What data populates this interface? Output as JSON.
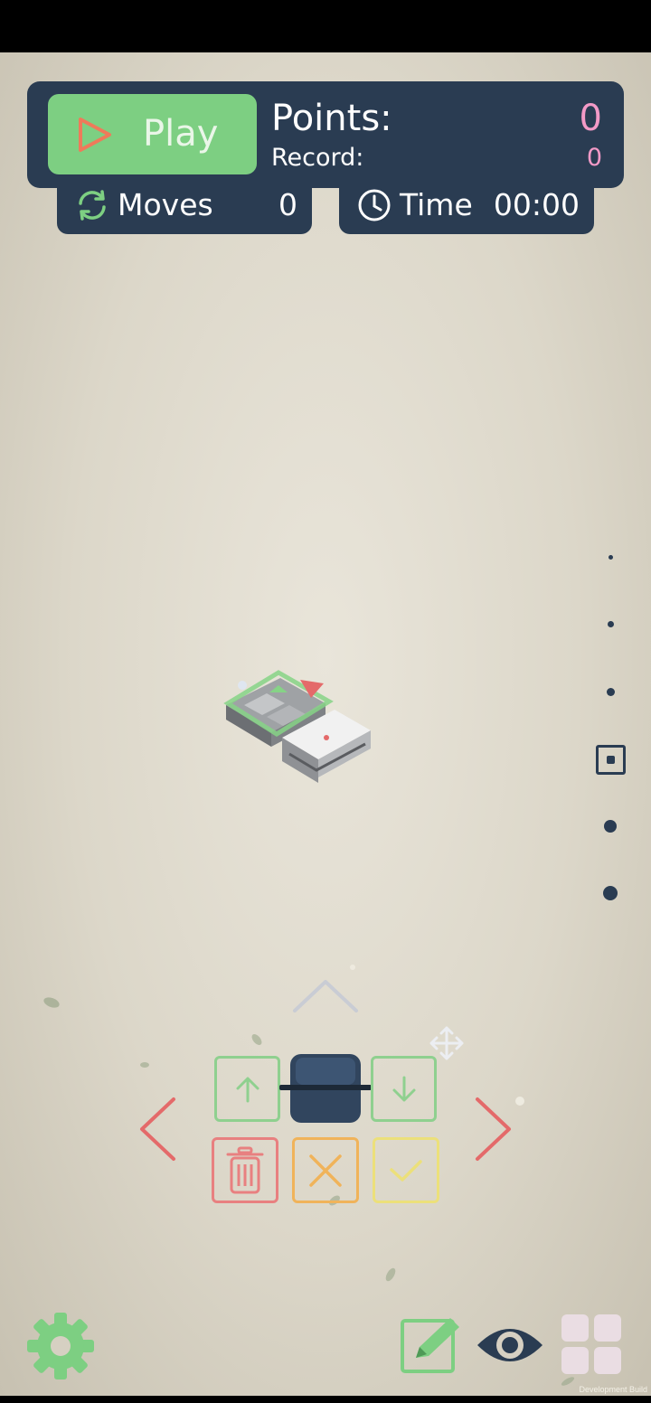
{
  "hud": {
    "play_label": "Play",
    "points_label": "Points:",
    "points_value": "0",
    "record_label": "Record:",
    "record_value": "0",
    "moves_label": "Moves",
    "moves_value": "0",
    "time_label": "Time",
    "time_value": "00:00"
  },
  "colors": {
    "panel": "#2a3c52",
    "play_green": "#7dcf82",
    "score_pink": "#f39ac7",
    "up_down_green": "#8fd08f",
    "delete_red": "#e88080",
    "cancel_orange": "#f0b35a",
    "confirm_yellow": "#ece07a"
  },
  "icons": {
    "play": "play-triangle-icon",
    "moves": "refresh-arrows-icon",
    "time": "clock-icon",
    "settings": "gear-icon",
    "edit": "pencil-square-icon",
    "view": "eye-icon",
    "menu": "grid-icon"
  },
  "footer": {
    "build_label": "Development Build"
  }
}
